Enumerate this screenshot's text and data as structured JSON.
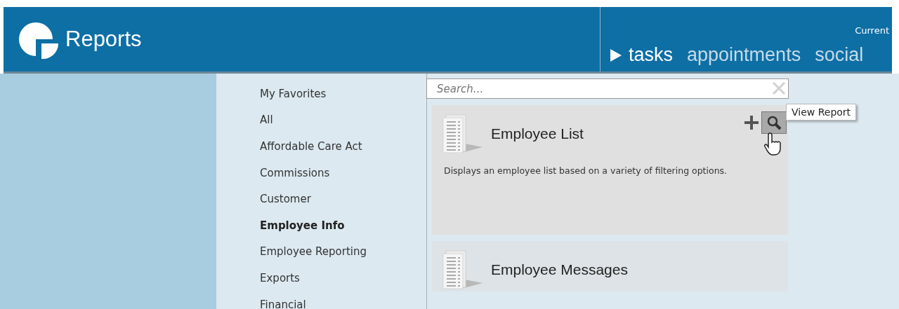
{
  "header": {
    "title": "Reports",
    "user_label": "Current",
    "nav": [
      {
        "label": "tasks",
        "selected": true
      },
      {
        "label": "appointments",
        "selected": false
      },
      {
        "label": "social",
        "selected": false
      }
    ]
  },
  "categories": [
    {
      "label": "My Favorites",
      "selected": false
    },
    {
      "label": "All",
      "selected": false
    },
    {
      "label": "Affordable Care Act",
      "selected": false
    },
    {
      "label": "Commissions",
      "selected": false
    },
    {
      "label": "Customer",
      "selected": false
    },
    {
      "label": "Employee Info",
      "selected": true
    },
    {
      "label": "Employee Reporting",
      "selected": false
    },
    {
      "label": "Exports",
      "selected": false
    },
    {
      "label": "Financial",
      "selected": false
    }
  ],
  "search": {
    "placeholder": "Search..."
  },
  "reports": [
    {
      "title": "Employee List",
      "description": "Displays an employee list based on a variety of filtering options.",
      "hovered": true,
      "tooltip": "View Report"
    },
    {
      "title": "Employee Messages",
      "hovered": false
    }
  ]
}
